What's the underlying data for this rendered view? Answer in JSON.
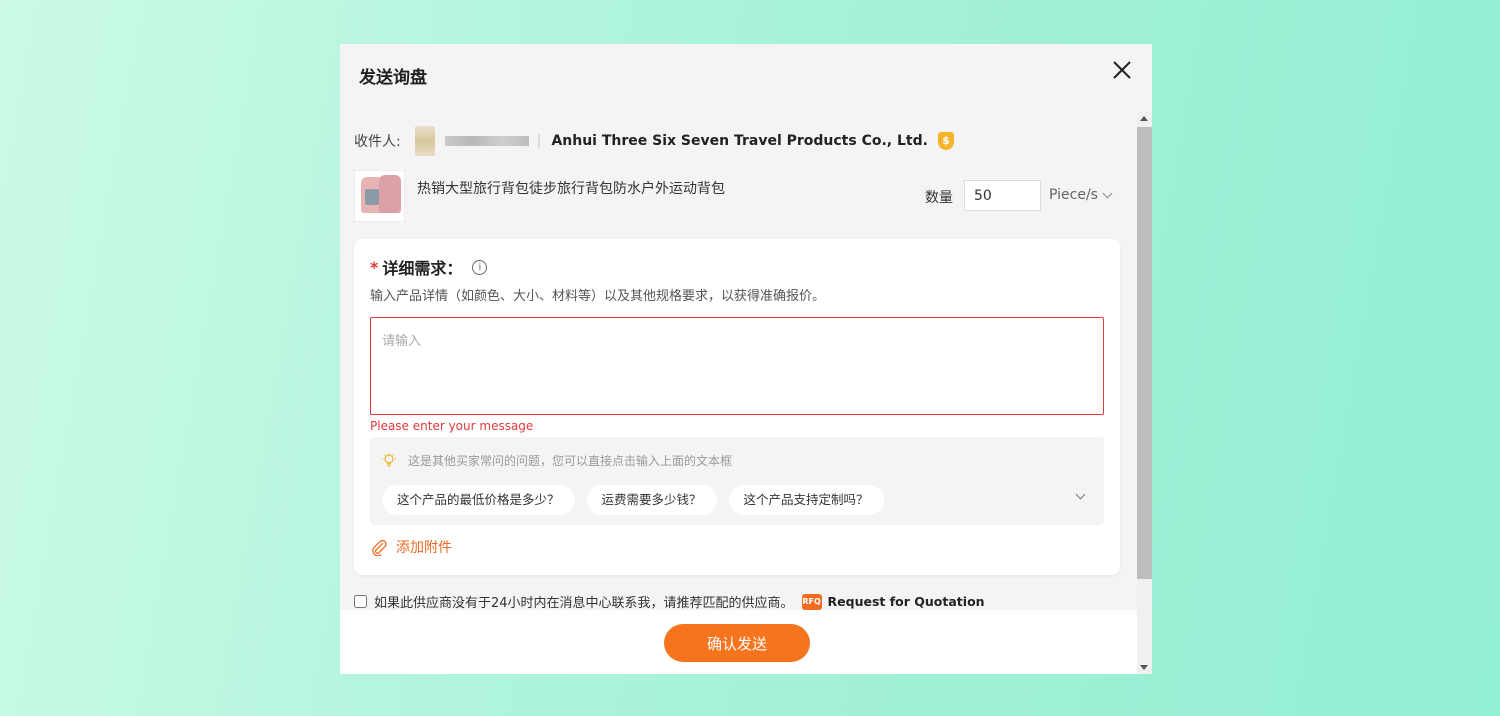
{
  "modal": {
    "title": "发送询盘"
  },
  "recipient": {
    "label": "收件人:",
    "separator": "|",
    "company": "Anhui Three Six Seven Travel Products Co., Ltd.",
    "verified_badge_icon": "gold-supplier-icon"
  },
  "product": {
    "name": "热销大型旅行背包徒步旅行背包防水户外运动背包",
    "quantity_label": "数量",
    "quantity_value": "50",
    "unit": "Piece/s"
  },
  "requirement": {
    "required_mark": "*",
    "title": "详细需求：",
    "info_glyph": "i",
    "description": "输入产品详情（如颜色、大小、材料等）以及其他规格要求，以获得准确报价。",
    "placeholder": "请输入",
    "error": "Please enter your message"
  },
  "faq": {
    "hint": "这是其他买家常问的问题，您可以直接点击输入上面的文本框",
    "questions": [
      "这个产品的最低价格是多少？",
      "运费需要多少钱？",
      "这个产品支持定制吗？"
    ]
  },
  "attachment": {
    "label": "添加附件"
  },
  "consent": {
    "text": "如果此供应商没有于24小时内在消息中心联系我，请推荐匹配的供应商。",
    "badge": "RFQ",
    "link_text": "Request for Quotation",
    "checked": false
  },
  "footer": {
    "confirm_label": "确认发送"
  },
  "colors": {
    "accent": "#f7741f",
    "error": "#e4393c",
    "verified": "#f7b32b"
  }
}
